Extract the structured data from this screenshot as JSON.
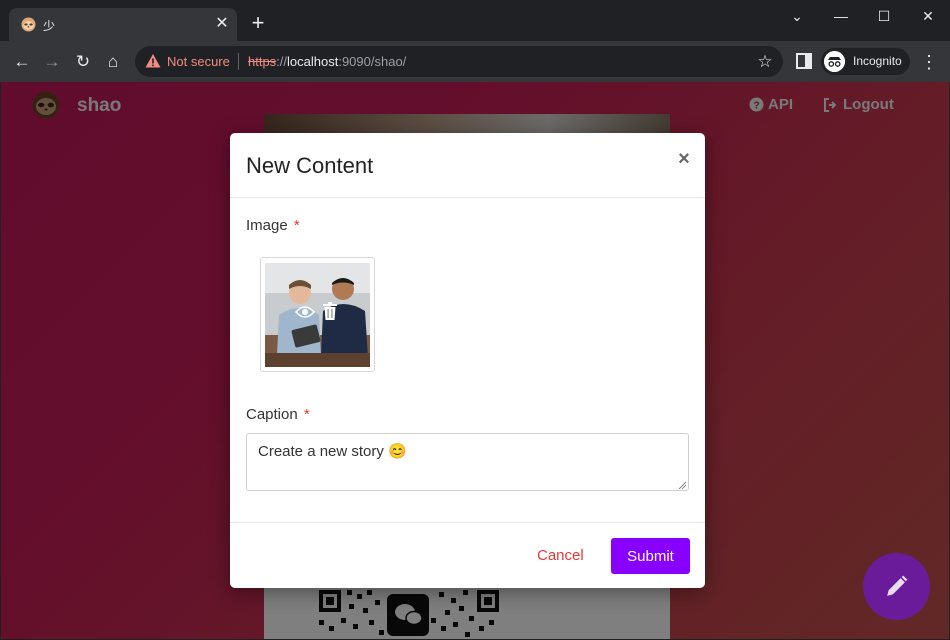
{
  "browser": {
    "tab_title": "少",
    "omnibox": {
      "security_label": "Not secure",
      "url_scheme": "https",
      "url_sep": "://",
      "url_host": "localhost",
      "url_path": ":9090/shao/"
    },
    "profile_label": "Incognito"
  },
  "app": {
    "brand": "shao",
    "nav": {
      "api_label": "API",
      "logout_label": "Logout"
    }
  },
  "modal": {
    "title": "New Content",
    "close_glyph": "×",
    "image_label": "Image",
    "caption_label": "Caption",
    "required_marker": "*",
    "caption_value": "Create a new story 😊",
    "cancel_label": "Cancel",
    "submit_label": "Submit"
  },
  "colors": {
    "accent_purple": "#8800ff",
    "danger_red": "#e53935",
    "fab_purple": "#6a1b9a"
  },
  "icons": [
    "shield-warning-icon",
    "star-icon",
    "eye-icon",
    "trash-icon",
    "pencil-icon",
    "question-circle-icon",
    "logout-icon"
  ]
}
